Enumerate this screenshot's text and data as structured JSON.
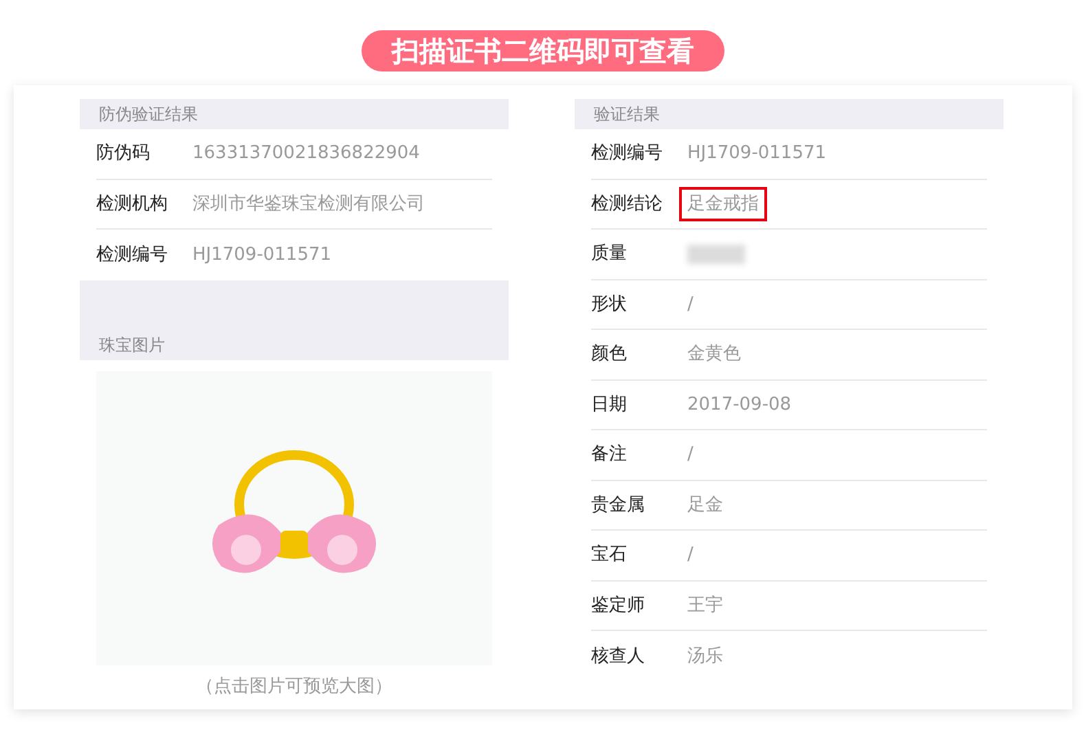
{
  "banner": {
    "text": "扫描证书二维码即可查看"
  },
  "anti_counterfeit": {
    "title": "防伪验证结果",
    "rows": [
      {
        "label": "防伪码",
        "value": "16331370021836822904"
      },
      {
        "label": "检测机构",
        "value": "深圳市华鉴珠宝检测有限公司"
      },
      {
        "label": "检测编号",
        "value": "HJ1709-011571"
      }
    ]
  },
  "jewelry_image": {
    "title": "珠宝图片",
    "caption": "（点击图片可预览大图）"
  },
  "verification": {
    "title": "验证结果",
    "rows": [
      {
        "label": "检测编号",
        "kind": "text",
        "value": "HJ1709-011571",
        "highlighted": false
      },
      {
        "label": "检测结论",
        "kind": "text",
        "value": "足金戒指",
        "highlighted": true
      },
      {
        "label": "质量",
        "kind": "blurred",
        "highlighted": false
      },
      {
        "label": "形状",
        "kind": "text",
        "value": "/",
        "highlighted": false
      },
      {
        "label": "颜色",
        "kind": "text",
        "value": "金黄色",
        "highlighted": false
      },
      {
        "label": "日期",
        "kind": "text",
        "value": "2017-09-08",
        "highlighted": false
      },
      {
        "label": "备注",
        "kind": "text",
        "value": "/",
        "highlighted": false
      },
      {
        "label": "贵金属",
        "kind": "text",
        "value": "足金",
        "highlighted": false
      },
      {
        "label": "宝石",
        "kind": "text",
        "value": "/",
        "highlighted": false
      },
      {
        "label": "鉴定师",
        "kind": "text",
        "value": "王宇",
        "highlighted": false
      },
      {
        "label": "核查人",
        "kind": "text",
        "value": "汤乐",
        "highlighted": false
      }
    ]
  }
}
